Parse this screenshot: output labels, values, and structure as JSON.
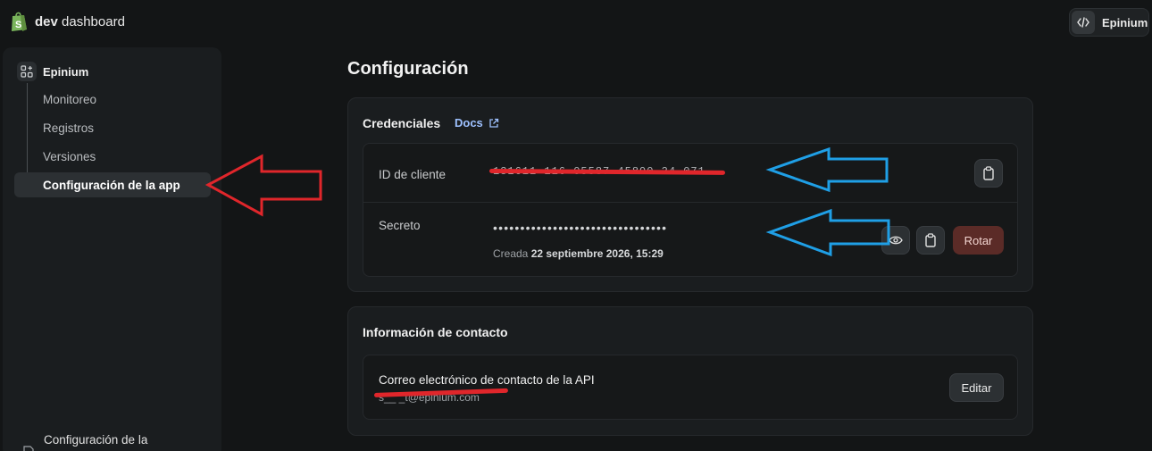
{
  "topbar": {
    "brand_bold": "dev",
    "brand_rest": "dashboard",
    "account_name": "Epinium",
    "account_icon": "code-icon",
    "logo_icon": "shopify-bag-icon"
  },
  "sidebar": {
    "app_name": "Epinium",
    "app_icon": "apps-grid-icon",
    "items": [
      {
        "label": "Monitoreo"
      },
      {
        "label": "Registros"
      },
      {
        "label": "Versiones"
      },
      {
        "label": "Configuración de la app",
        "active": true
      }
    ],
    "bottom_label": "Configuración de la"
  },
  "page": {
    "title": "Configuración"
  },
  "credentials": {
    "title": "Credenciales",
    "docs_label": "Docs",
    "client_id_label": "ID de cliente",
    "client_id_value": "131611 116 05587 45890 24 071",
    "secret_label": "Secreto",
    "secret_value": "••••••••••••••••••••••••••••••••",
    "created_prefix": "Creada",
    "created_date": "22 septiembre 2026, 15:29",
    "rotate_label": "Rotar"
  },
  "contact": {
    "title": "Información de contacto",
    "email_label": "Correo electrónico de contacto de la API",
    "email_value": "s__ _t@epinium.com",
    "edit_label": "Editar"
  },
  "colors": {
    "background": "#131516",
    "panel": "#1a1d1f",
    "accent_link": "#9ec1ff",
    "danger_button": "#5b2b27",
    "annotation_red": "#e0262b",
    "annotation_blue": "#1f9fe6"
  }
}
